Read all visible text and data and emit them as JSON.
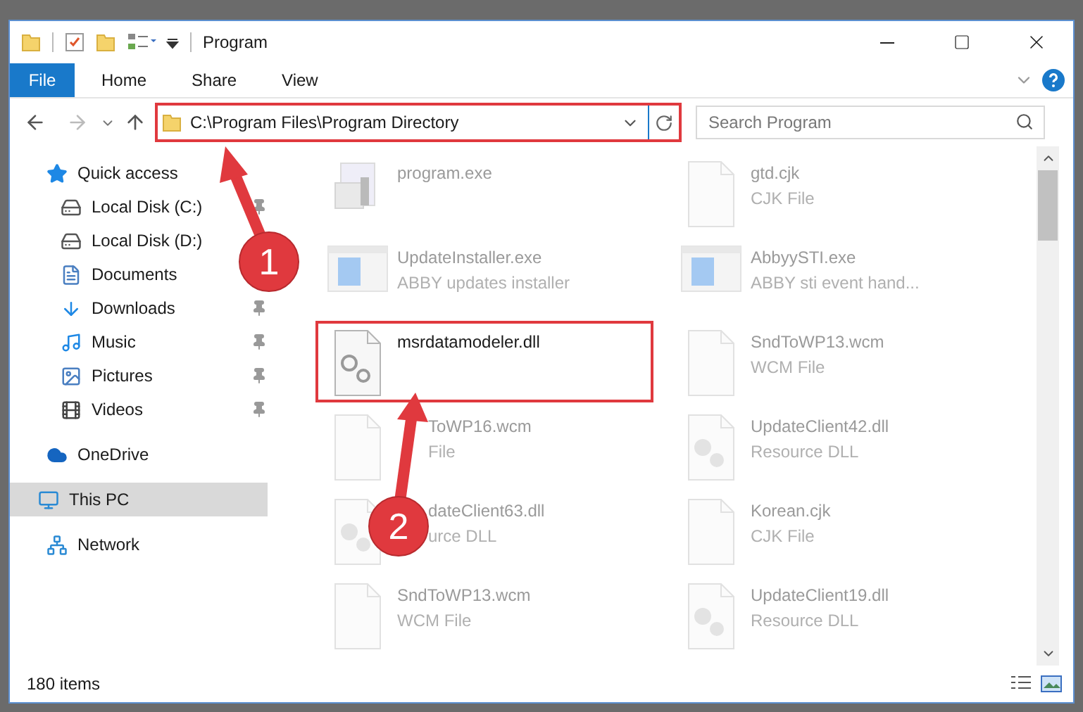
{
  "window": {
    "title": "Program"
  },
  "ribbon_tabs": [
    {
      "label": "File",
      "kind": "file"
    },
    {
      "label": "Home",
      "kind": "tab"
    },
    {
      "label": "Share",
      "kind": "tab"
    },
    {
      "label": "View",
      "kind": "tab"
    }
  ],
  "address_bar": {
    "path": "C:\\Program Files\\Program Directory",
    "highlighted": true
  },
  "search": {
    "placeholder": "Search Program"
  },
  "sidebar": {
    "items": [
      {
        "label": "Quick access",
        "kind": "star",
        "selected": false,
        "children": [
          {
            "label": "Local Disk (C:)",
            "kind": "drive",
            "pinned": true,
            "selected": false
          },
          {
            "label": "Local Disk (D:)",
            "kind": "drive",
            "selected": false
          },
          {
            "label": "Documents",
            "kind": "documents",
            "selected": false
          },
          {
            "label": "Downloads",
            "kind": "downloads",
            "pinned": true,
            "selected": false
          },
          {
            "label": "Music",
            "kind": "music",
            "pinned": true,
            "selected": false
          },
          {
            "label": "Pictures",
            "kind": "pictures",
            "pinned": true,
            "selected": false
          },
          {
            "label": "Videos",
            "kind": "videos",
            "pinned": true,
            "selected": false
          }
        ]
      },
      {
        "label": "OneDrive",
        "kind": "cloud",
        "selected": false
      },
      {
        "label": "This PC",
        "kind": "computer",
        "selected": true
      },
      {
        "label": "Network",
        "kind": "network",
        "selected": false
      }
    ]
  },
  "files": [
    {
      "name": "program.exe",
      "kind": "application",
      "faded": true,
      "highlighted": false,
      "covered": false
    },
    {
      "name": "gtd.cjk",
      "type": "CJK File",
      "kind": "document",
      "faded": true,
      "highlighted": false,
      "covered": false
    },
    {
      "name": "UpdateInstaller.exe",
      "type": "ABBY updates installer",
      "kind": "installer",
      "faded": true,
      "highlighted": false,
      "covered": false
    },
    {
      "name": "AbbyySTI.exe",
      "type": "ABBY sti event hand...",
      "kind": "installer",
      "faded": true,
      "highlighted": false,
      "covered": false
    },
    {
      "name": "msrdatamodeler.dll",
      "kind": "library",
      "faded": false,
      "highlighted": true,
      "covered": false
    },
    {
      "name": "SndToWP13.wcm",
      "type": "WCM File",
      "kind": "document",
      "faded": true,
      "highlighted": false,
      "covered": false
    },
    {
      "name": "ToWP16.wcm",
      "type": "File",
      "kind": "document",
      "faded": true,
      "highlighted": false,
      "covered": true
    },
    {
      "name": "UpdateClient42.dll",
      "type": "Resource DLL",
      "kind": "resource",
      "faded": true,
      "highlighted": false,
      "covered": false
    },
    {
      "name": "dateClient63.dll",
      "type": "urce DLL",
      "kind": "resource",
      "faded": true,
      "highlighted": false,
      "covered": true
    },
    {
      "name": "Korean.cjk",
      "type": "CJK File",
      "kind": "document",
      "faded": true,
      "highlighted": false,
      "covered": false
    },
    {
      "name": "SndToWP13.wcm",
      "type": "WCM File",
      "kind": "document",
      "faded": true,
      "highlighted": false,
      "covered": false
    },
    {
      "name": "UpdateClient19.dll",
      "type": "Resource DLL",
      "kind": "resource",
      "faded": true,
      "highlighted": false,
      "covered": false
    }
  ],
  "status_bar": {
    "count": "180 items"
  },
  "annotations": [
    {
      "number": "1"
    },
    {
      "number": "2"
    }
  ]
}
